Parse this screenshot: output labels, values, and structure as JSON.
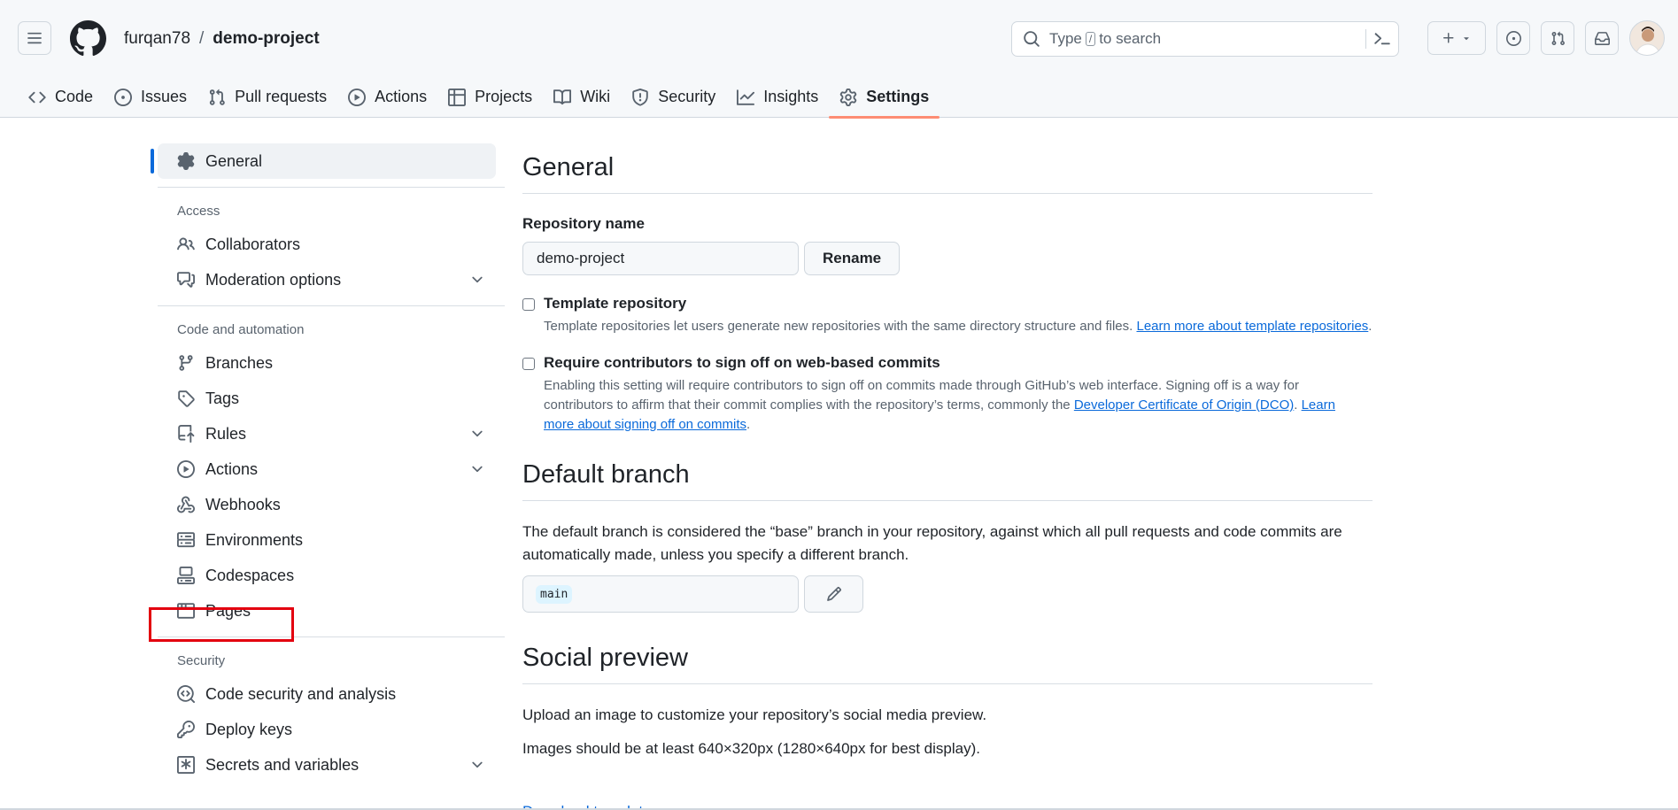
{
  "header": {
    "owner": "furqan78",
    "separator": "/",
    "repo": "demo-project",
    "search_prefix": "Type",
    "search_key": "/",
    "search_suffix": "to search"
  },
  "tabs": [
    {
      "label": "Code",
      "icon": "code-icon"
    },
    {
      "label": "Issues",
      "icon": "issue-icon"
    },
    {
      "label": "Pull requests",
      "icon": "pull-request-icon"
    },
    {
      "label": "Actions",
      "icon": "play-icon"
    },
    {
      "label": "Projects",
      "icon": "table-icon"
    },
    {
      "label": "Wiki",
      "icon": "book-icon"
    },
    {
      "label": "Security",
      "icon": "shield-icon"
    },
    {
      "label": "Insights",
      "icon": "graph-icon"
    },
    {
      "label": "Settings",
      "icon": "gear-icon"
    }
  ],
  "sidebar": {
    "general": "General",
    "access_heading": "Access",
    "collaborators": "Collaborators",
    "moderation": "Moderation options",
    "code_heading": "Code and automation",
    "branches": "Branches",
    "tags": "Tags",
    "rules": "Rules",
    "actions": "Actions",
    "webhooks": "Webhooks",
    "environments": "Environments",
    "codespaces": "Codespaces",
    "pages": "Pages",
    "security_heading": "Security",
    "code_security": "Code security and analysis",
    "deploy_keys": "Deploy keys",
    "secrets": "Secrets and variables"
  },
  "general": {
    "title": "General",
    "repo_name_label": "Repository name",
    "repo_name_value": "demo-project",
    "rename_label": "Rename",
    "template_title": "Template repository",
    "template_desc": "Template repositories let users generate new repositories with the same directory structure and files.",
    "template_link": "Learn more about template repositories",
    "signoff_title": "Require contributors to sign off on web-based commits",
    "signoff_desc": "Enabling this setting will require contributors to sign off on commits made through GitHub’s web interface. Signing off is a way for contributors to affirm that their commit complies with the repository’s terms, commonly the",
    "signoff_link1": "Developer Certificate of Origin (DCO)",
    "signoff_link2": "Learn more about signing off on commits"
  },
  "default_branch": {
    "title": "Default branch",
    "desc": "The default branch is considered the “base” branch in your repository, against which all pull requests and code commits are automatically made, unless you specify a different branch.",
    "branch": "main"
  },
  "social_preview": {
    "title": "Social preview",
    "desc": "Upload an image to customize your repository’s social media preview.",
    "size_note": "Images should be at least 640×320px (1280×640px for best display).",
    "download_link": "Download template"
  },
  "colors": {
    "accent": "#0969da",
    "active_tab_underline": "#fd8c73",
    "highlight_box": "#e3000f"
  }
}
